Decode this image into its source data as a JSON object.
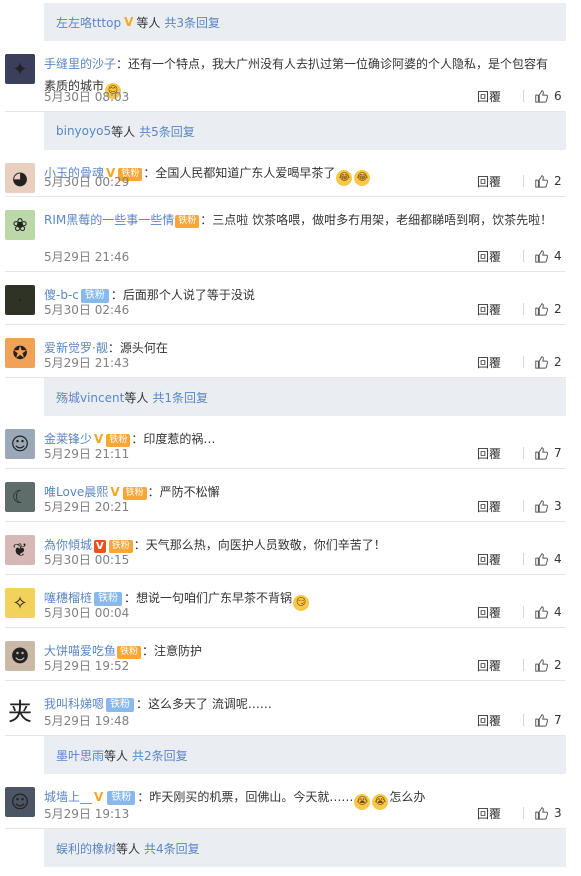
{
  "colors": {
    "link": "#5a86c2",
    "sub_reply_bg": "#eaeef2",
    "time": "#808080",
    "vip_gold": "#f5a623"
  },
  "labels": {
    "reply": "回覆",
    "more_prefix": "等人",
    "tie_fan": "铁粉",
    "vip_v": "V"
  },
  "items": [
    {
      "kind": "sub",
      "name": "左左咯tttop",
      "vip": true,
      "suffix": "等人",
      "more": "共3条回复"
    },
    {
      "kind": "comment",
      "avatar": "avatar-dark-bird",
      "avatar_bg": "#3a3f5c",
      "avatar_glyph": "✦",
      "name": "手缝里的沙子",
      "badges": [],
      "text": "：还有一个特点，我大广州没有人去扒过第一位确诊阿婆的个人隐私，是个包容有素质的城市",
      "emoji": [
        "😊"
      ],
      "time": "5月30日 08:03",
      "likes": "6"
    },
    {
      "kind": "sub",
      "name": "binyoyo5",
      "vip": false,
      "suffix": "等人",
      "more": "共5条回复"
    },
    {
      "kind": "comment",
      "avatar": "avatar-baby",
      "avatar_bg": "#e8cfc0",
      "avatar_glyph": "◕",
      "name": "小玉的骨魂",
      "badges": [
        "v",
        "fan"
      ],
      "text": "：全国人民都知道广东人爱喝早茶了",
      "emoji": [
        "😂",
        "😂"
      ],
      "time": "5月30日 00:29",
      "likes": "2"
    },
    {
      "kind": "comment",
      "avatar": "avatar-plant",
      "avatar_bg": "#bcd7a8",
      "avatar_glyph": "❀",
      "name": "RIM黑莓的一些事一些情",
      "badges": [
        "fan"
      ],
      "text": "：三点啦 饮茶咯喂，做咁多冇用架，老细都睇唔到啊，饮茶先啦！",
      "emoji": [],
      "time": "5月29日 21:46",
      "likes": "4"
    },
    {
      "kind": "comment",
      "avatar": "avatar-dark",
      "avatar_bg": "#2f3326",
      "avatar_glyph": "·",
      "name": "傻-b-c",
      "badges": [
        "tie"
      ],
      "text": "：后面那个人说了等于没说",
      "emoji": [],
      "time": "5月30日 02:46",
      "likes": "2"
    },
    {
      "kind": "comment",
      "avatar": "avatar-goku",
      "avatar_bg": "#f1a257",
      "avatar_glyph": "✪",
      "name": "爱新觉罗·靓",
      "badges": [],
      "text": "：源头何在",
      "emoji": [],
      "time": "5月29日 21:43",
      "likes": "2"
    },
    {
      "kind": "sub",
      "name": "殇城vincent",
      "vip": false,
      "suffix": "等人",
      "more": "共1条回复"
    },
    {
      "kind": "comment",
      "avatar": "avatar-man",
      "avatar_bg": "#9aa8b8",
      "avatar_glyph": "☺",
      "name": "金莱锋少",
      "badges": [
        "v",
        "fan"
      ],
      "text": "：印度惹的祸…",
      "emoji": [],
      "time": "5月29日 21:11",
      "likes": "7"
    },
    {
      "kind": "comment",
      "avatar": "avatar-girl",
      "avatar_bg": "#5e6d6a",
      "avatar_glyph": "☾",
      "name": "唯Love晨熙",
      "badges": [
        "v",
        "fan"
      ],
      "text": "：严防不松懈",
      "emoji": [],
      "time": "5月29日 20:21",
      "likes": "3"
    },
    {
      "kind": "comment",
      "avatar": "avatar-woman",
      "avatar_bg": "#d8b8b6",
      "avatar_glyph": "❦",
      "name": "為你傾城",
      "badges": [
        "vred",
        "fan"
      ],
      "text": "：天气那么热，向医护人员致敬，你们辛苦了！",
      "emoji": [],
      "time": "5月30日 00:15",
      "likes": "4"
    },
    {
      "kind": "comment",
      "avatar": "avatar-cartoon",
      "avatar_bg": "#f2d25a",
      "avatar_glyph": "✧",
      "name": "噻穗榴梿",
      "badges": [
        "tie"
      ],
      "text": "：想说一句咱们广东早茶不背锅",
      "emoji": [
        "😏"
      ],
      "time": "5月30日 00:04",
      "likes": "4"
    },
    {
      "kind": "comment",
      "avatar": "avatar-hat",
      "avatar_bg": "#c9b9a6",
      "avatar_glyph": "☻",
      "name": "大饼喵爱吃鱼",
      "badges": [
        "fan"
      ],
      "text": "：注意防护",
      "emoji": [],
      "time": "5月29日 19:52",
      "likes": "2"
    },
    {
      "kind": "comment",
      "avatar": "avatar-char",
      "avatar_bg": "#ffffff",
      "avatar_glyph": "夹",
      "name": "我叫科娣嗯",
      "badges": [
        "tie"
      ],
      "text": "：这么多天了 流调呢……",
      "emoji": [],
      "time": "5月29日 19:48",
      "likes": "7"
    },
    {
      "kind": "sub",
      "name": "墨叶思雨",
      "vip": false,
      "suffix": "等人",
      "more": "共2条回复"
    },
    {
      "kind": "comment",
      "avatar": "avatar-guy",
      "avatar_bg": "#4b5563",
      "avatar_glyph": "☺",
      "name": "城墙上__",
      "badges": [
        "v",
        "tie"
      ],
      "text": "：昨天刚买的机票，回佛山。今天就……",
      "emoji": [
        "😭",
        "😭"
      ],
      "text_after": "怎么办",
      "time": "5月29日 19:13",
      "likes": "3"
    },
    {
      "kind": "sub",
      "name": "蜈利的橡树",
      "vip": false,
      "suffix": "等人",
      "more": "共4条回复"
    }
  ]
}
